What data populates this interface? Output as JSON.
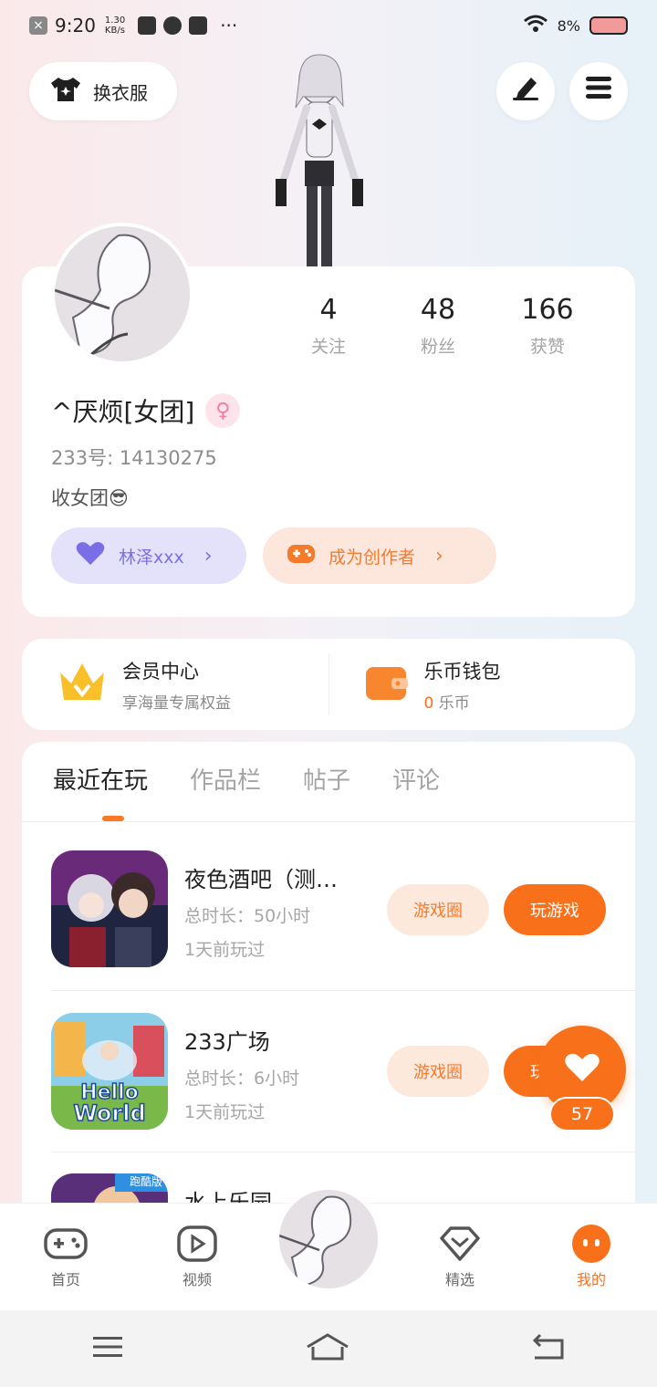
{
  "status_bar": {
    "time": "9:20",
    "net_speed": "1.30\nKB/s",
    "more": "···",
    "battery": "8%"
  },
  "top": {
    "outfit_label": "换衣服"
  },
  "stats": [
    {
      "num": "4",
      "label": "关注"
    },
    {
      "num": "48",
      "label": "粉丝"
    },
    {
      "num": "166",
      "label": "获赞"
    }
  ],
  "profile": {
    "nickname": "^厌烦[女团]",
    "uid": "233号: 14130275",
    "signature": "收女团😎",
    "mate_label": "林泽xxx",
    "creator_label": "成为创作者"
  },
  "member": {
    "title": "会员中心",
    "subtitle": "享海量专属权益"
  },
  "wallet": {
    "title": "乐币钱包",
    "amount": "0",
    "unit": "乐币"
  },
  "tabs": [
    "最近在玩",
    "作品栏",
    "帖子",
    "评论"
  ],
  "games": [
    {
      "title": "夜色酒吧（测…",
      "duration": "总时长：50小时",
      "last": "1天前玩过",
      "circle": "游戏圈",
      "play": "玩游戏"
    },
    {
      "title": "233广场",
      "duration": "总时长：6小时",
      "last": "1天前玩过",
      "circle": "游戏圈",
      "play": "玩游戏"
    },
    {
      "title": "水上乐园",
      "badge": "跑酷版"
    }
  ],
  "float_like": {
    "count": "57"
  },
  "bottom_nav": [
    {
      "label": "首页"
    },
    {
      "label": "视频"
    },
    {
      "label": ""
    },
    {
      "label": "精选"
    },
    {
      "label": "我的"
    }
  ],
  "colors": {
    "accent": "#f8701a",
    "purple": "#7b6fe8",
    "pink": "#f07fa2"
  }
}
